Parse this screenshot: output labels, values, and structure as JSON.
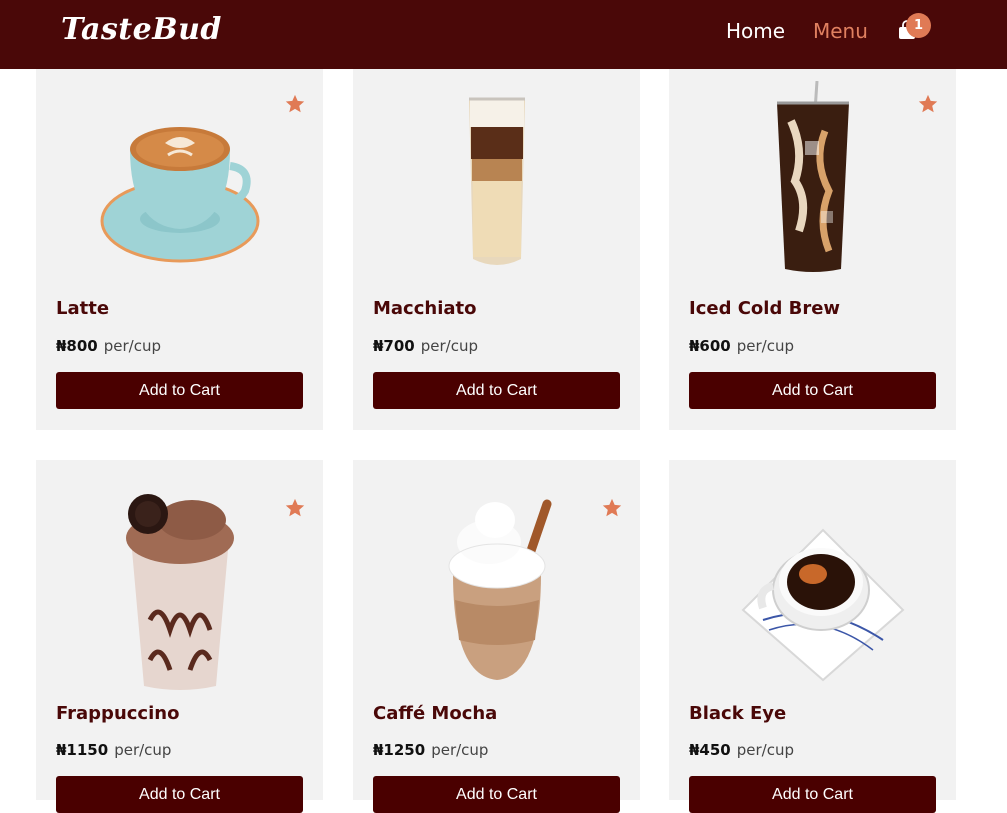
{
  "header": {
    "logo": "TasteBud",
    "nav": [
      {
        "label": "Home"
      },
      {
        "label": "Menu"
      }
    ],
    "cart_count": "1"
  },
  "colors": {
    "header_bg": "#4a0808",
    "accent": "#e07a55",
    "button_bg": "#4a0000"
  },
  "products": [
    {
      "name": "Latte",
      "price": "₦800",
      "unit": "per/cup",
      "button": "Add to Cart",
      "favorite": true,
      "icon": "latte-cup"
    },
    {
      "name": "Macchiato",
      "price": "₦700",
      "unit": "per/cup",
      "button": "Add to Cart",
      "favorite": false,
      "icon": "macchiato-glass"
    },
    {
      "name": "Iced Cold Brew",
      "price": "₦600",
      "unit": "per/cup",
      "button": "Add to Cart",
      "favorite": true,
      "icon": "iced-brew-glass"
    },
    {
      "name": "Frappuccino",
      "price": "₦1150",
      "unit": "per/cup",
      "button": "Add to Cart",
      "favorite": true,
      "icon": "frappuccino-cup"
    },
    {
      "name": "Caffé Mocha",
      "price": "₦1250",
      "unit": "per/cup",
      "button": "Add to Cart",
      "favorite": true,
      "icon": "mocha-glass"
    },
    {
      "name": "Black Eye",
      "price": "₦450",
      "unit": "per/cup",
      "button": "Add to Cart",
      "favorite": false,
      "icon": "black-eye-cup"
    }
  ]
}
